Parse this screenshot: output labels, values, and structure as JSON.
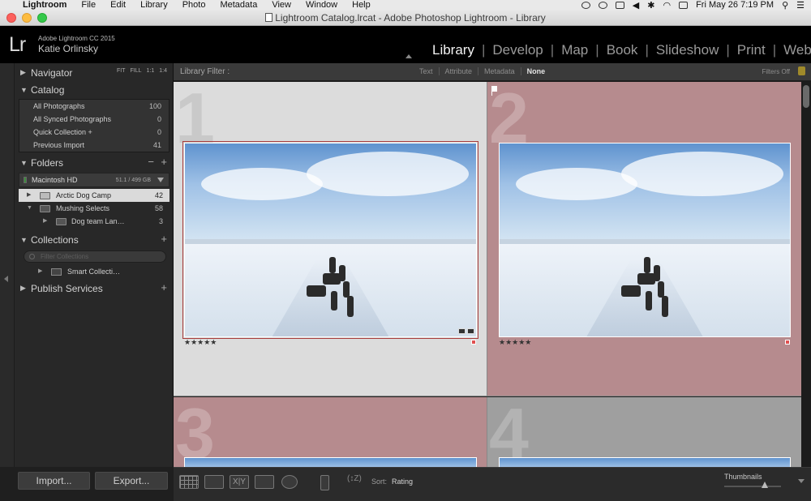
{
  "menubar": {
    "app": "Lightroom",
    "items": [
      "File",
      "Edit",
      "Library",
      "Photo",
      "Metadata",
      "View",
      "Window",
      "Help"
    ],
    "clock": "Fri May 26  7:19 PM"
  },
  "window": {
    "title": "Lightroom Catalog.lrcat - Adobe Photoshop Lightroom - Library"
  },
  "identity": {
    "logo": "Lr",
    "product": "Adobe Lightroom CC 2015",
    "user": "Katie Orlinsky"
  },
  "modules": [
    "Library",
    "Develop",
    "Map",
    "Book",
    "Slideshow",
    "Print",
    "Web"
  ],
  "active_module": "Library",
  "navigator": {
    "title": "Navigator",
    "zoom_options": [
      "FIT",
      "FILL",
      "1:1",
      "1:4"
    ]
  },
  "catalog": {
    "title": "Catalog",
    "items": [
      {
        "label": "All Photographs",
        "count": "100"
      },
      {
        "label": "All Synced Photographs",
        "count": "0"
      },
      {
        "label": "Quick Collection  +",
        "count": "0"
      },
      {
        "label": "Previous Import",
        "count": "41"
      }
    ]
  },
  "folders": {
    "title": "Folders",
    "volume": {
      "name": "Macintosh HD",
      "size": "51.1 / 499 GB"
    },
    "items": [
      {
        "label": "Arctic Dog Camp",
        "count": "42"
      },
      {
        "label": "Mushing Selects",
        "count": "58"
      },
      {
        "label": "Dog team Lan…",
        "count": "3"
      }
    ]
  },
  "collections": {
    "title": "Collections",
    "filter_placeholder": "Filter Collections",
    "items": [
      {
        "label": "Smart Collecti…"
      }
    ]
  },
  "publish": {
    "title": "Publish Services"
  },
  "buttons": {
    "import": "Import...",
    "export": "Export..."
  },
  "filterbar": {
    "title": "Library Filter :",
    "tabs": [
      "Text",
      "Attribute",
      "Metadata",
      "None"
    ],
    "active_tab": "None",
    "filters_state": "Filters Off"
  },
  "grid": {
    "cells": [
      {
        "index": "1",
        "rating": "★★★★★",
        "selected": true
      },
      {
        "index": "2",
        "rating": "★★★★★",
        "selected": false
      },
      {
        "index": "3"
      },
      {
        "index": "4"
      }
    ]
  },
  "toolbar": {
    "sort_label": "Sort:",
    "sort_value": "Rating",
    "thumbnails_label": "Thumbnails",
    "thumbnail_size": 0.72
  },
  "colors": {
    "selected_cell": "#dcdcdc",
    "red_label_cell": "#b68b8e",
    "gray_cell": "#9f9f9f",
    "selection_outline": "#a83d3d"
  }
}
